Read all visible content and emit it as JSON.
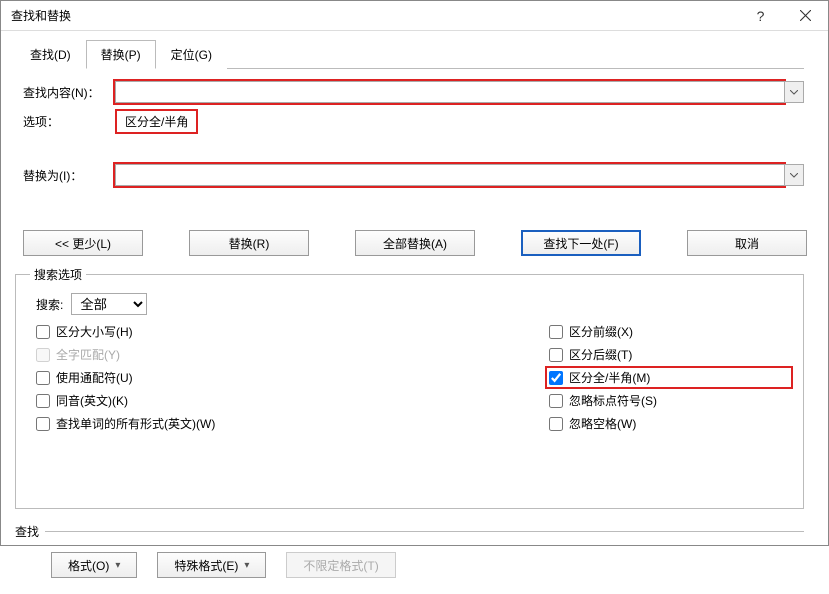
{
  "window": {
    "title": "查找和替换"
  },
  "tabs": {
    "find": "查找(D)",
    "replace": "替换(P)",
    "goto": "定位(G)"
  },
  "labels": {
    "find_what": "查找内容(N)：",
    "options": "选项：",
    "options_value": "区分全/半角",
    "replace_with": "替换为(I)："
  },
  "buttons": {
    "less": "<< 更少(L)",
    "replace": "替换(R)",
    "replace_all": "全部替换(A)",
    "find_next": "查找下一处(F)",
    "cancel": "取消",
    "format": "格式(O)",
    "special": "特殊格式(E)",
    "noformat": "不限定格式(T)"
  },
  "search_options": {
    "legend": "搜索选项",
    "search_label": "搜索:",
    "direction": "全部",
    "left": {
      "match_case": "区分大小写(H)",
      "whole_word": "全字匹配(Y)",
      "use_wildcards": "使用通配符(U)",
      "sounds_like": "同音(英文)(K)",
      "all_forms": "查找单词的所有形式(英文)(W)"
    },
    "right": {
      "match_prefix": "区分前缀(X)",
      "match_suffix": "区分后缀(T)",
      "match_width": "区分全/半角(M)",
      "ignore_punct": "忽略标点符号(S)",
      "ignore_space": "忽略空格(W)"
    }
  },
  "find_group": {
    "legend": "查找"
  }
}
